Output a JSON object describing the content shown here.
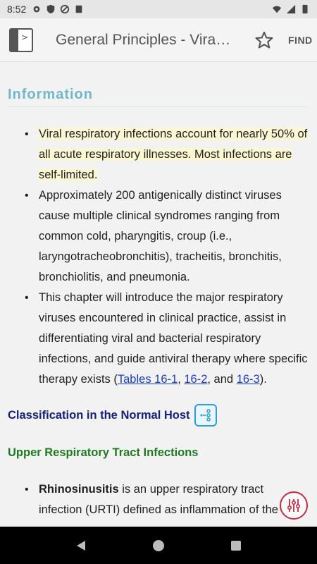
{
  "status_bar": {
    "time": "8:52"
  },
  "app_bar": {
    "title": "General Principles - Vira…",
    "find_label": "FIND"
  },
  "section": {
    "title": "Information"
  },
  "bullets": [
    {
      "text": "Viral respiratory infections account for nearly 50% of all acute respiratory illnesses. Most infections are self-limited."
    },
    {
      "text": "Approximately 200 antigenically distinct viruses cause multiple clinical syndromes ranging from common cold, pharyngitis, croup (i.e., laryngotracheobronchitis), tracheitis, bronchitis, bronchiolitis, and pneumonia."
    },
    {
      "text_before": "This chapter will introduce the major respiratory viruses encountered in clinical practice, assist in differentiating viral and bacterial respiratory infections, and guide antiviral therapy where specific therapy exists (",
      "link1": "Tables 16-1",
      "sep1": ", ",
      "link2": "16-2",
      "sep2": ", and ",
      "link3": "16-3",
      "text_after": ")."
    }
  ],
  "classification_heading": "Classification in the Normal Host",
  "upper_heading": "Upper Respiratory Tract Infections",
  "rhino": {
    "bold": "Rhinosinusitis",
    "text": " is an upper respiratory tract infection (URTI) defined as inflammation of the"
  },
  "colors": {
    "section_heading": "#6fb8cc",
    "class_heading": "#15207a",
    "upper_heading": "#1f7a1f",
    "link": "#1a3ccc",
    "highlight": "#fbf7d2",
    "fab": "#c82a45"
  }
}
